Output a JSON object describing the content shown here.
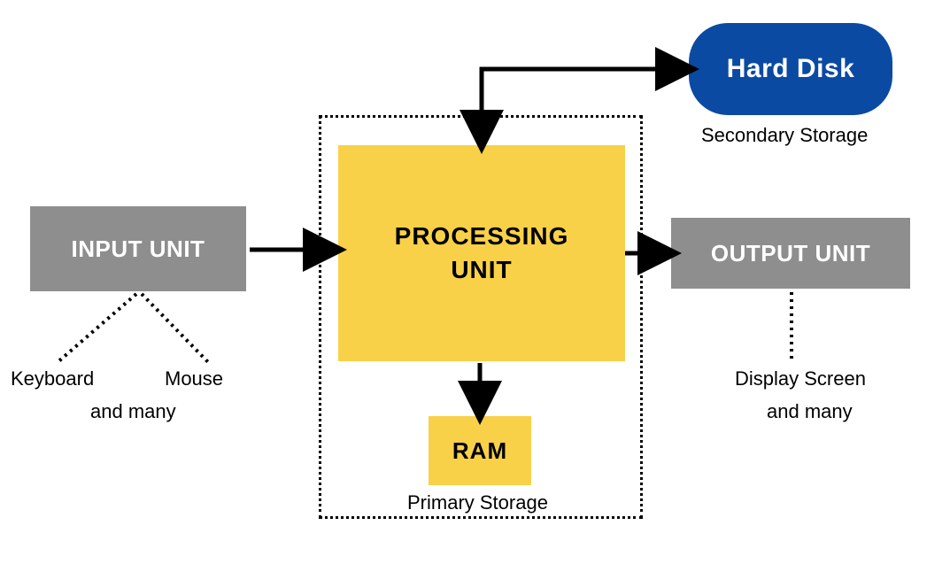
{
  "blocks": {
    "input_unit": "INPUT UNIT",
    "processing_unit_line1": "PROCESSING",
    "processing_unit_line2": "UNIT",
    "output_unit": "OUTPUT UNIT",
    "ram": "RAM",
    "hard_disk": "Hard Disk"
  },
  "labels": {
    "keyboard": "Keyboard",
    "mouse": "Mouse",
    "and_many_left": "and many",
    "secondary_storage": "Secondary Storage",
    "display_screen": "Display Screen",
    "and_many_right": "and many",
    "primary_storage": "Primary Storage"
  },
  "colors": {
    "gray": "#8e8e8e",
    "yellow": "#f8d148",
    "blue": "#0b4aa3"
  }
}
